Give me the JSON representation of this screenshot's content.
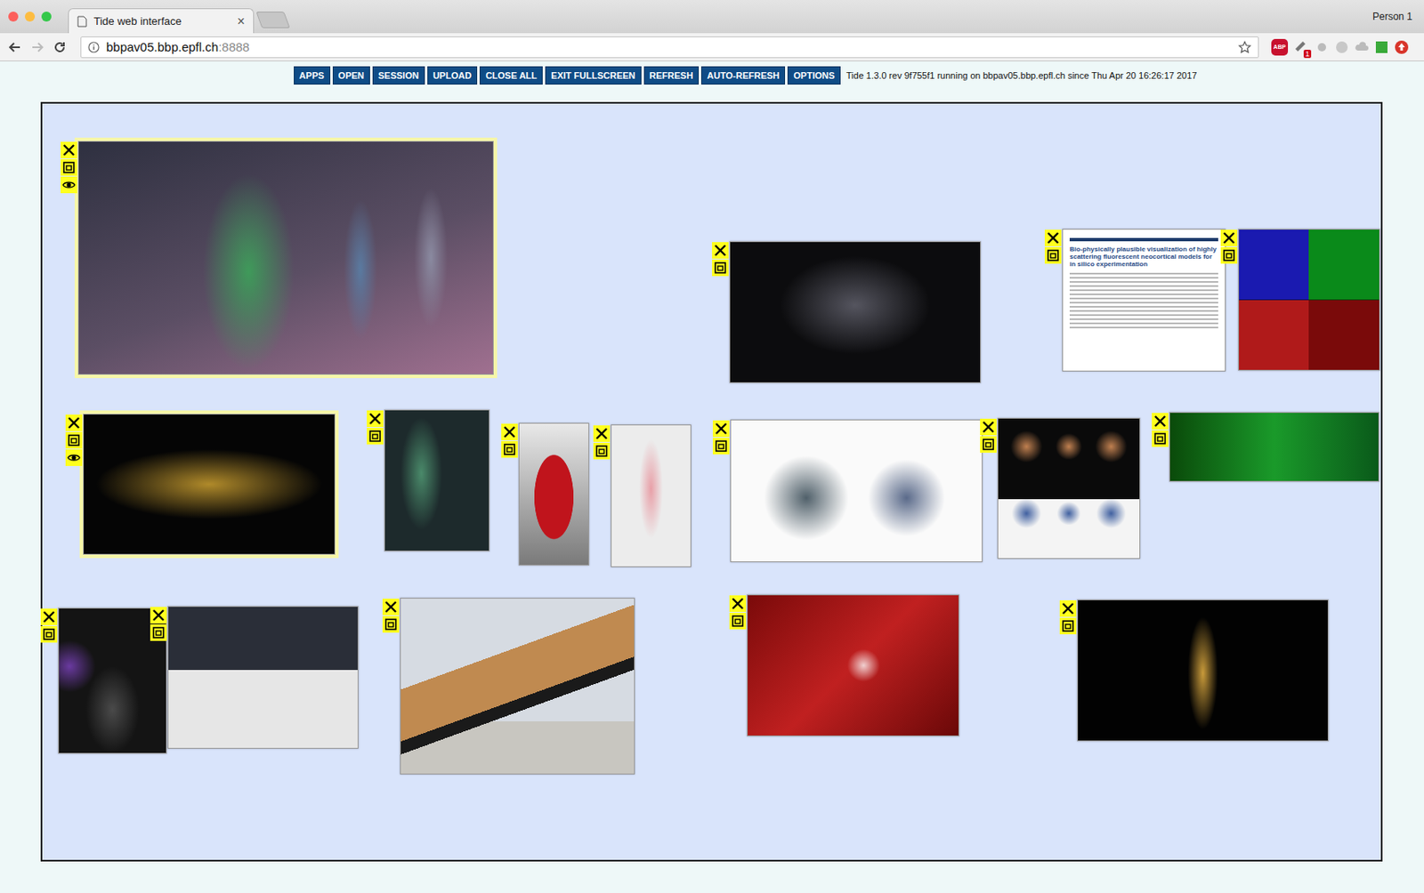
{
  "window": {
    "title": "Tide web interface"
  },
  "browser": {
    "tabs": [
      {
        "label": "Tide web interface",
        "close": "×",
        "selected": true
      }
    ],
    "profile": "Person 1",
    "address_bar": {
      "host": "bbpav05.bbp.epfl.ch",
      "port": ":8888"
    },
    "extensions": [
      {
        "label": "ABP",
        "badge": ""
      },
      {
        "label": "",
        "badge": "1"
      }
    ]
  },
  "toolbar": {
    "buttons": [
      "APPS",
      "OPEN",
      "SESSION",
      "UPLOAD",
      "CLOSE ALL",
      "EXIT FULLSCREEN",
      "REFRESH",
      "AUTO-REFRESH",
      "OPTIONS"
    ],
    "status": "Tide 1.3.0 rev 9f755f1 running on bbpav05.bbp.epfl.ch since Thu Apr 20 16:26:17 2017"
  },
  "wall": {
    "windows": [
      {
        "kind": "image",
        "focused": true
      },
      {
        "kind": "image",
        "focused": false
      },
      {
        "kind": "document",
        "focused": false,
        "title": "Bio-physically plausible visualization of highly scattering fluorescent neocortical models for in silico experimentation"
      },
      {
        "kind": "image",
        "focused": false
      },
      {
        "kind": "image",
        "focused": true
      },
      {
        "kind": "image",
        "focused": false
      },
      {
        "kind": "image",
        "focused": false
      },
      {
        "kind": "image",
        "focused": false
      },
      {
        "kind": "image",
        "focused": false
      },
      {
        "kind": "image",
        "focused": false
      },
      {
        "kind": "image",
        "focused": false
      },
      {
        "kind": "image",
        "focused": false
      },
      {
        "kind": "image",
        "focused": false
      },
      {
        "kind": "image",
        "focused": false
      },
      {
        "kind": "image",
        "focused": false
      },
      {
        "kind": "image",
        "focused": false
      }
    ]
  }
}
